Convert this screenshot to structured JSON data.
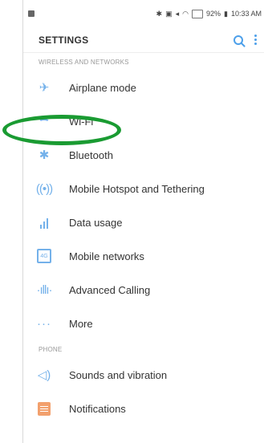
{
  "status": {
    "battery": "92%",
    "time": "10:33 AM"
  },
  "header": {
    "title": "SETTINGS"
  },
  "sections": {
    "wireless": "WIRELESS AND NETWORKS",
    "phone": "PHONE"
  },
  "items": {
    "airplane": "Airplane mode",
    "wifi": "Wi-Fi",
    "bluetooth": "Bluetooth",
    "hotspot": "Mobile Hotspot and Tethering",
    "data_usage": "Data usage",
    "mobile_networks": "Mobile networks",
    "advanced_calling": "Advanced Calling",
    "more": "More",
    "sounds": "Sounds and vibration",
    "notifications": "Notifications"
  },
  "colors": {
    "accent": "#4da0ea",
    "highlight": "#1a9b32",
    "orange": "#f08a5d"
  }
}
